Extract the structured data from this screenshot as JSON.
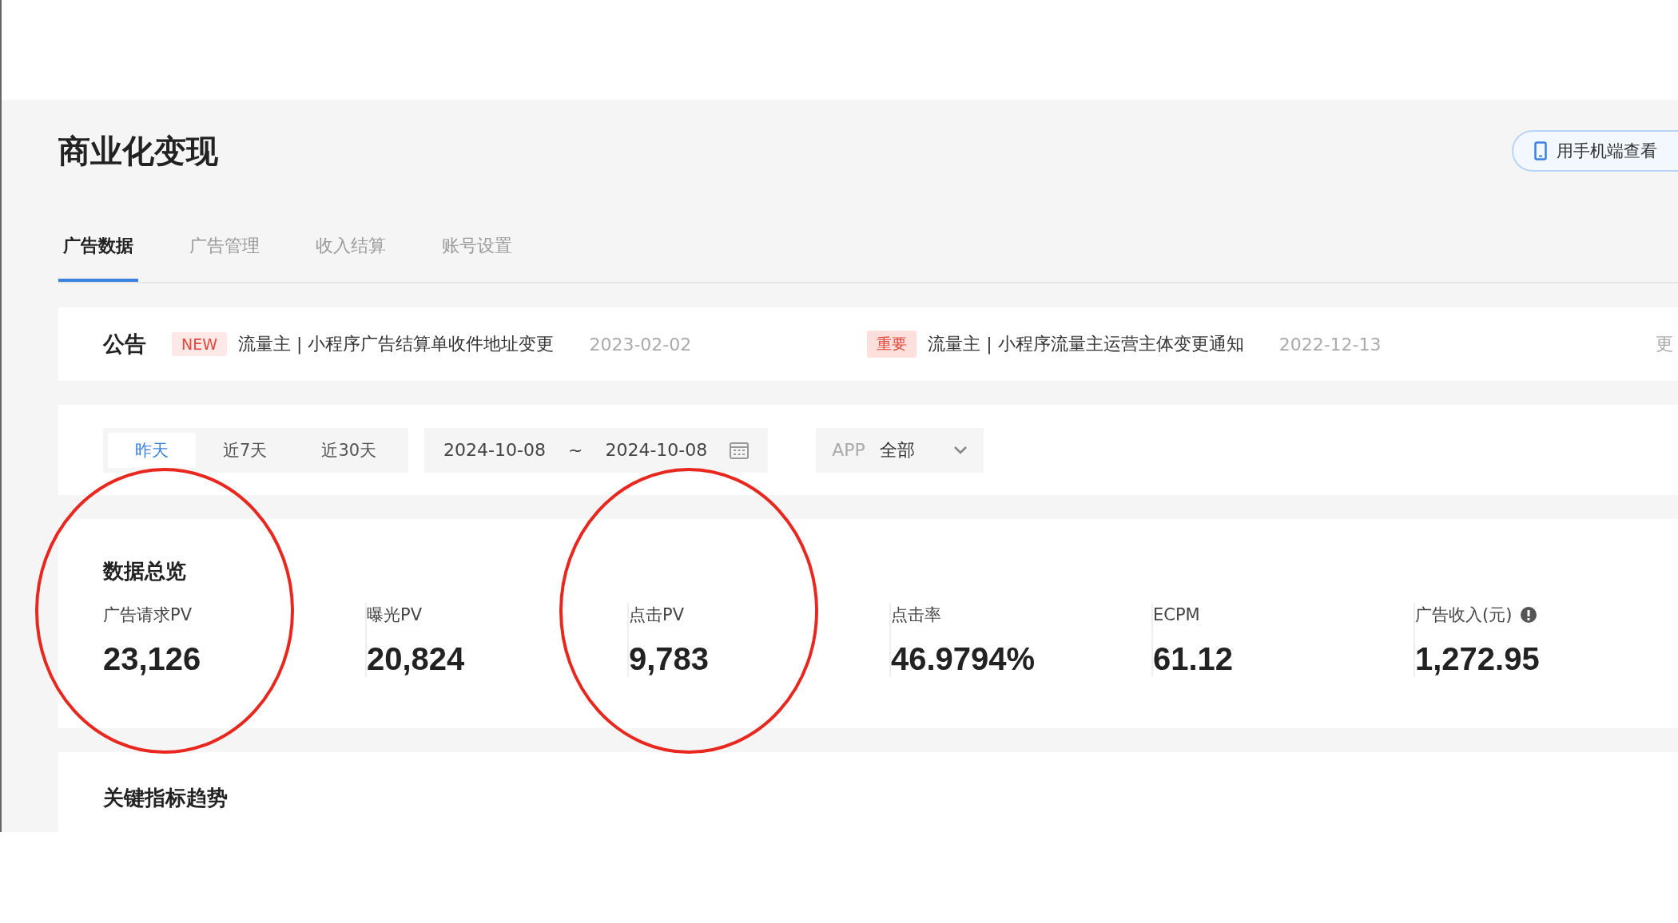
{
  "page_title": "商业化变现",
  "mobile_button": "用手机端查看",
  "tabs": [
    {
      "label": "广告数据",
      "selected": true
    },
    {
      "label": "广告管理",
      "selected": false
    },
    {
      "label": "收入结算",
      "selected": false
    },
    {
      "label": "账号设置",
      "selected": false
    }
  ],
  "notice": {
    "heading": "公告",
    "more": "更",
    "items": [
      {
        "kind": "new",
        "tag": "NEW",
        "text": "流量主 | 小程序广告结算单收件地址变更",
        "date": "2023-02-02"
      },
      {
        "kind": "important",
        "tag": "重要",
        "text": "流量主 | 小程序流量主运营主体变更通知",
        "date": "2022-12-13"
      }
    ]
  },
  "filters": {
    "ranges": [
      {
        "label": "昨天",
        "selected": true
      },
      {
        "label": "近7天",
        "selected": false
      },
      {
        "label": "近30天",
        "selected": false
      }
    ],
    "start_date": "2024-10-08",
    "separator": "~",
    "end_date": "2024-10-08",
    "app_label": "APP",
    "app_value": "全部"
  },
  "overview": {
    "title": "数据总览",
    "stats": [
      {
        "label": "广告请求PV",
        "value": "23,126",
        "circled": true,
        "info": false
      },
      {
        "label": "曝光PV",
        "value": "20,824",
        "circled": false,
        "info": false
      },
      {
        "label": "点击PV",
        "value": "9,783",
        "circled": true,
        "info": false
      },
      {
        "label": "点击率",
        "value": "46.9794%",
        "circled": false,
        "info": false
      },
      {
        "label": "ECPM",
        "value": "61.12",
        "circled": false,
        "info": false
      },
      {
        "label": "广告收入(元)",
        "value": "1,272.95",
        "circled": false,
        "info": true
      }
    ]
  },
  "trend": {
    "title": "关键指标趋势"
  }
}
